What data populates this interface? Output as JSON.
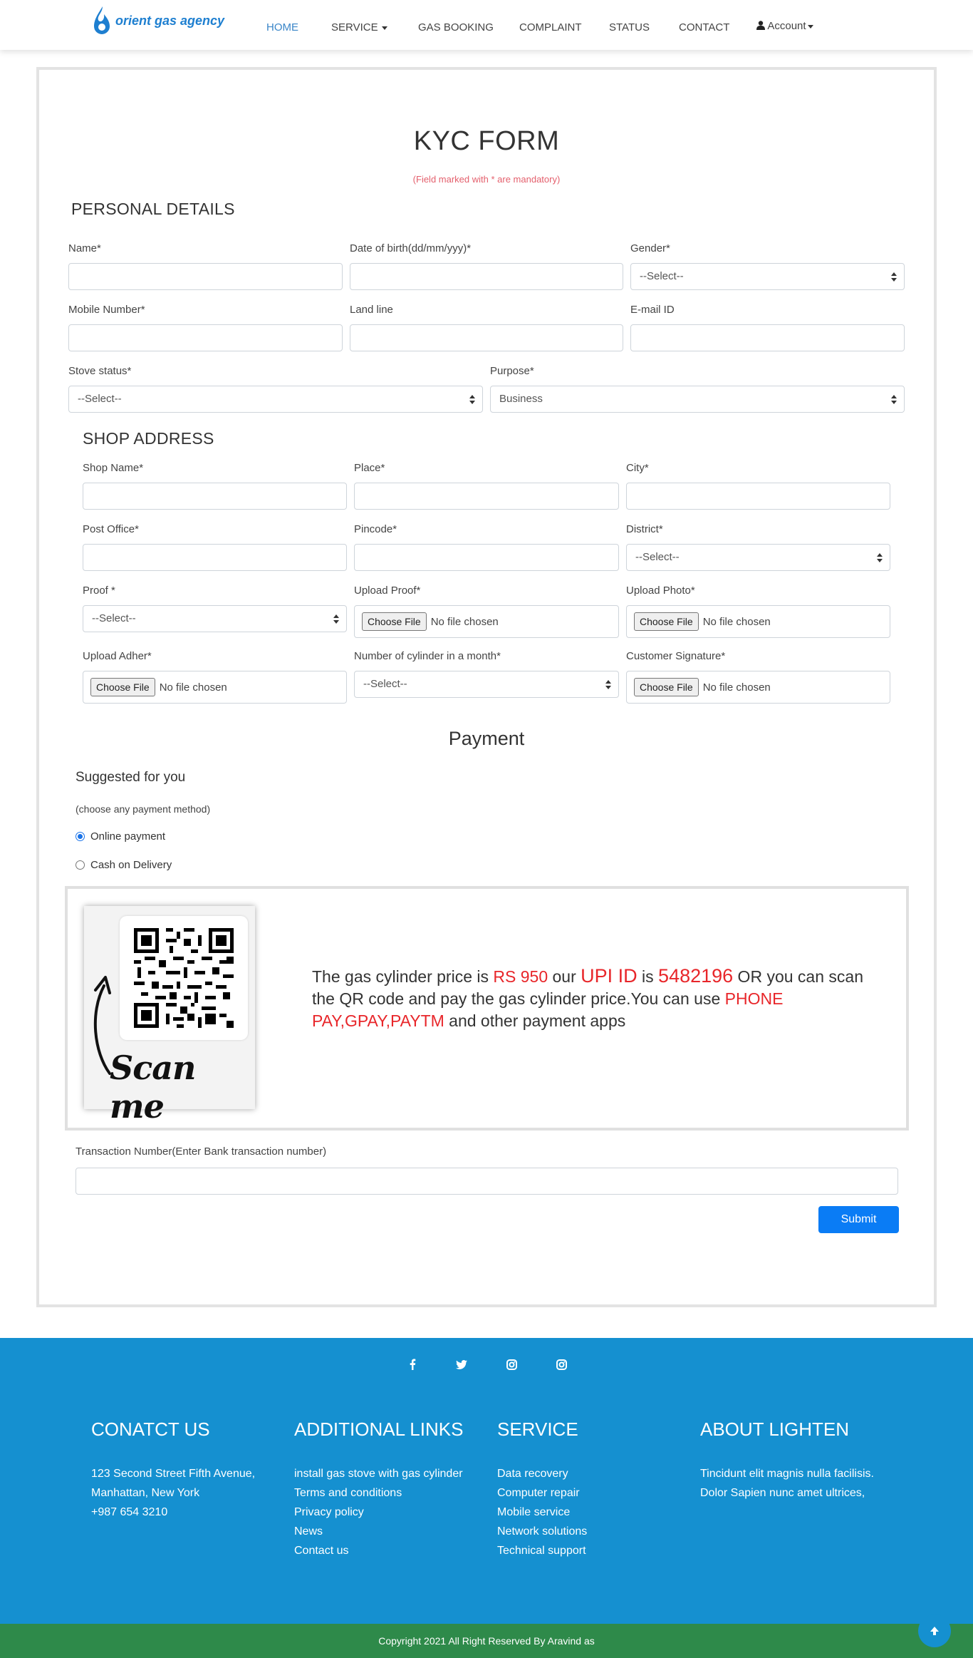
{
  "navbar": {
    "brand": "orient gas agency",
    "links": [
      "HOME",
      "SERVICE",
      "GAS BOOKING",
      "COMPLAINT",
      "STATUS",
      "CONTACT"
    ],
    "account": "Account"
  },
  "form": {
    "title": "KYC FORM",
    "mandatory_note": "(Field marked with * are mandatory)",
    "personal": {
      "heading": "PERSONAL DETAILS",
      "name": "Name*",
      "dob": "Date of birth(dd/mm/yyy)*",
      "gender": "Gender*",
      "gender_value": "--Select--",
      "mobile": "Mobile Number*",
      "landline": "Land line",
      "email": "E-mail ID",
      "stove": "Stove status*",
      "stove_value": "--Select--",
      "purpose": "Purpose*",
      "purpose_value": "Business"
    },
    "shop": {
      "heading": "SHOP ADDRESS",
      "shop_name": "Shop Name*",
      "place": "Place*",
      "city": "City*",
      "post_office": "Post Office*",
      "pincode": "Pincode*",
      "district": "District*",
      "district_value": "--Select--",
      "proof": "Proof *",
      "proof_value": "--Select--",
      "upload_proof": "Upload Proof*",
      "upload_photo": "Upload Photo*",
      "upload_adher": "Upload Adher*",
      "cylinders": "Number of cylinder in a month*",
      "cylinders_value": "--Select--",
      "signature": "Customer Signature*",
      "file_button": "Choose File",
      "file_status": "No file chosen"
    }
  },
  "payment": {
    "title": "Payment",
    "suggested": "Suggested for you",
    "choose": "(choose any payment method)",
    "option_online": "Online payment",
    "option_cod": "Cash on Delivery",
    "scan_me": "Scan me",
    "text_1": "The gas cylinder price is ",
    "price": "RS 950",
    "text_2": " our ",
    "upi_label": "UPI ID",
    "text_3": " is ",
    "upi_id": "5482196",
    "text_4": " OR you can scan the QR code and pay the gas cylinder price.You can use ",
    "apps": "PHONE PAY,GPAY,PAYTM",
    "text_5": " and other payment apps",
    "txn_label": "Transaction Number(Enter Bank transaction number)",
    "submit": "Submit"
  },
  "footer": {
    "contact": {
      "heading": "CONATCT US",
      "lines": [
        "123 Second Street Fifth Avenue,",
        "Manhattan, New York",
        "+987 654 3210"
      ]
    },
    "links": {
      "heading": "ADDITIONAL LINKS",
      "items": [
        "install gas stove with gas cylinder",
        "Terms and conditions",
        "Privacy policy",
        "News",
        "Contact us"
      ]
    },
    "service": {
      "heading": "SERVICE",
      "items": [
        "Data recovery",
        "Computer repair",
        "Mobile service",
        "Network solutions",
        "Technical support"
      ]
    },
    "about": {
      "heading": "ABOUT LIGHTEN",
      "lines": [
        "Tincidunt elit magnis nulla facilisis.",
        "Dolor Sapien nunc amet ultrices,"
      ]
    },
    "social_icons": [
      "facebook-icon",
      "twitter-icon",
      "instagram-icon",
      "instagram-icon"
    ],
    "copyright": "Copyright 2021 All Right Reserved By Aravind as"
  },
  "colors": {
    "accent": "#1590d0",
    "submit": "#0a7cf5",
    "highlight": "#e8262a",
    "copyright_bar": "#2e8a4a"
  }
}
